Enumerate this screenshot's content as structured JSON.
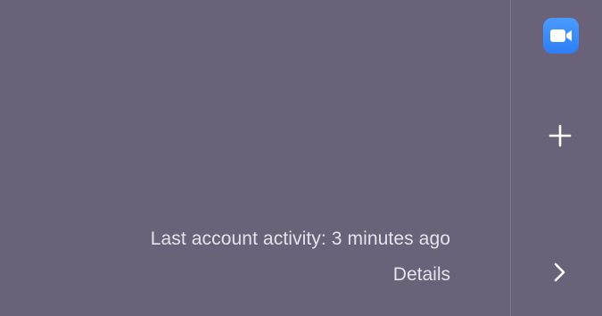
{
  "main": {
    "activity_text": "Last account activity: 3 minutes ago",
    "details_link": "Details"
  },
  "rail": {
    "app_icon": "zoom-video-camera-icon",
    "add_icon": "plus-icon",
    "expand_icon": "chevron-right-icon"
  },
  "colors": {
    "background": "#6a6279",
    "text": "#e6e2ea",
    "zoom_blue": "#2d8cff",
    "divider": "#7d768c"
  }
}
